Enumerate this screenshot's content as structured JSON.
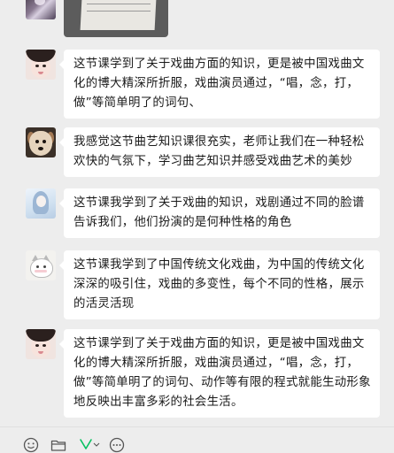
{
  "messages": [
    {
      "text": "这节课学到了关于戏曲方面的知识，更是被中国戏曲文化的博大精深所折服，戏曲演员通过，“唱，念，打，做”等简单明了的词句、"
    },
    {
      "text": "我感觉这节曲艺知识课很充实，老师让我们在一种轻松欢快的气氛下，学习曲艺知识并感受戏曲艺术的美妙"
    },
    {
      "text": "这节课我学到了关于戏曲的知识，戏剧通过不同的脸谱告诉我们，他们扮演的是何种性格的角色"
    },
    {
      "text": "这节课我学到了中国传统文化戏曲，为中国的传统文化深深的吸引住，戏曲的多变性，每个不同的性格，展示的活灵活现"
    },
    {
      "text": "这节课学到了关于戏曲方面的知识，更是被中国戏曲文化的博大精深所折服，戏曲演员通过，“唱，念，打，做”等简单明了的词句、动作等有限的程式就能生动形象地反映出丰富多彩的社会生活。"
    }
  ],
  "toolbar": {
    "icons": [
      "emoji-icon",
      "folder-icon",
      "scissors-icon",
      "chat-history-icon"
    ]
  },
  "colors": {
    "background": "#ededed",
    "bubble": "#ffffff",
    "text": "#1a1a1a",
    "scissors_accent": "#07c160"
  }
}
